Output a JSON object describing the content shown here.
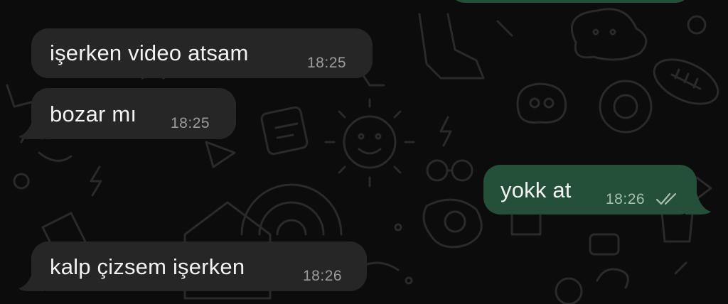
{
  "colors": {
    "background": "#0c0c0c",
    "incoming_bubble": "#262626",
    "outgoing_bubble": "#245039",
    "timestamp": "#9b9b9b",
    "outgoing_timestamp": "#a8bfae",
    "message_text": "#f2f2f2"
  },
  "messages": [
    {
      "direction": "incoming",
      "text": "işerken video atsam",
      "time": "18:25"
    },
    {
      "direction": "incoming",
      "text": "bozar mı",
      "time": "18:25"
    },
    {
      "direction": "outgoing",
      "text": "yokk at",
      "time": "18:26",
      "status_icon": "double-check-icon"
    },
    {
      "direction": "incoming",
      "text": "kalp çizsem işerken",
      "time": "18:26"
    }
  ]
}
